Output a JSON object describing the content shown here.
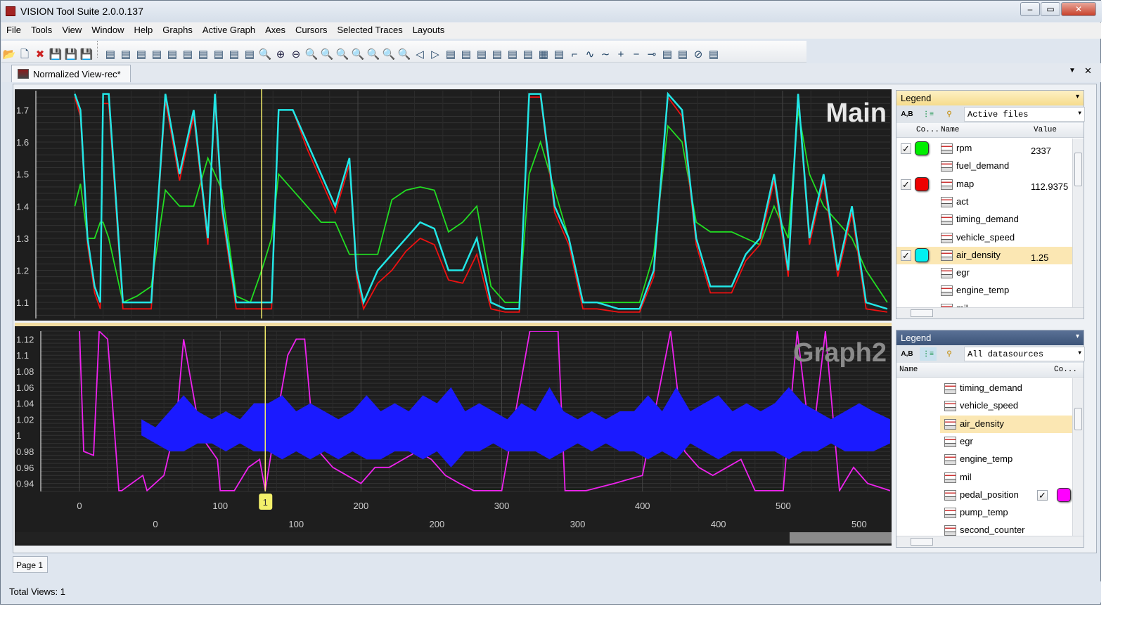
{
  "window": {
    "title": "VISION Tool Suite 2.0.0.137",
    "minimize": "–",
    "maximize": "▭",
    "close": "✕"
  },
  "menu": [
    "File",
    "Tools",
    "View",
    "Window",
    "Help",
    "Graphs",
    "Active Graph",
    "Axes",
    "Cursors",
    "Selected Traces",
    "Layouts"
  ],
  "toolbar": [
    "open-folder",
    "new-file",
    "close-file",
    "save",
    "save-as",
    "save-all",
    "sep",
    "add-table",
    "remove-table",
    "table-props",
    "y-axis-table",
    "y-axis-1",
    "y-axis-2",
    "open-layout",
    "layout-1",
    "layout-2",
    "layout-3",
    "zoom-fit",
    "zoom-in",
    "zoom-out",
    "zoom-horizontal",
    "zoom-vertical",
    "zoom-cursor",
    "zoom-help",
    "zoom-back",
    "zoom-disabled",
    "zoom-full",
    "cursor-left",
    "cursor-right",
    "cursor-numbers",
    "cursor-table",
    "traces-check",
    "traces-uncheck",
    "trace-edit",
    "trace-stack",
    "grid",
    "line-points",
    "line-steps",
    "line-smooth",
    "line-wave",
    "add",
    "remove",
    "link",
    "link-points",
    "annotate",
    "clear-graph",
    "color-map"
  ],
  "document_tab": "Normalized View-rec*",
  "graphs": [
    {
      "title": "Main",
      "cursor_label": "1"
    },
    {
      "title": "Graph2",
      "cursor_label": "1"
    }
  ],
  "legend_top": {
    "header": "Legend",
    "pin": "📌",
    "tool_ab": "A,B",
    "filter": "Active files",
    "columns": {
      "color": "Co...",
      "name": "Name",
      "value": "Value"
    },
    "rows": [
      {
        "name": "rpm",
        "checked": true,
        "color": "#00ee00",
        "value": "2337"
      },
      {
        "name": "fuel_demand"
      },
      {
        "name": "map",
        "checked": true,
        "color": "#ee0000",
        "value": "112.9375"
      },
      {
        "name": "act"
      },
      {
        "name": "timing_demand"
      },
      {
        "name": "vehicle_speed"
      },
      {
        "name": "air_density",
        "checked": true,
        "color": "#00f0f0",
        "value": "1.25",
        "selected": true
      },
      {
        "name": "egr"
      },
      {
        "name": "engine_temp"
      },
      {
        "name": "mil"
      }
    ]
  },
  "legend_bottom": {
    "header": "Legend",
    "pin": "📌",
    "tool_ab": "A,B",
    "filter": "All datasources",
    "columns": {
      "name": "Name",
      "color": "Co..."
    },
    "rows": [
      {
        "name": "timing_demand"
      },
      {
        "name": "vehicle_speed"
      },
      {
        "name": "air_density",
        "selected": true
      },
      {
        "name": "egr"
      },
      {
        "name": "engine_temp"
      },
      {
        "name": "mil"
      },
      {
        "name": "pedal_position",
        "checked": true,
        "color": "#ff00ff"
      },
      {
        "name": "pump_temp"
      },
      {
        "name": "second_counter"
      }
    ]
  },
  "page_tab": "Page 1",
  "status": "Total Views: 1",
  "chart_data": [
    {
      "type": "line",
      "title": "Main",
      "ylim": [
        1.05,
        1.76
      ],
      "xlim": [
        -27.5,
        576
      ],
      "yticks": [
        "1.7",
        "1.6",
        "1.5",
        "1.4",
        "1.3",
        "1.2",
        "1.1"
      ],
      "grid": true,
      "cursor_x": 132,
      "x": [
        0,
        4,
        9,
        14,
        18,
        20,
        24,
        34,
        44,
        54,
        64,
        74,
        84,
        94,
        99,
        104,
        114,
        124,
        132,
        139,
        144,
        154,
        164,
        174,
        184,
        194,
        199,
        204,
        214,
        224,
        234,
        244,
        254,
        264,
        274,
        284,
        294,
        304,
        314,
        321,
        329,
        339,
        349,
        359,
        369,
        384,
        399,
        409,
        419,
        429,
        439,
        449,
        464,
        474,
        484,
        494,
        504,
        511,
        519,
        529,
        539,
        549,
        559,
        574
      ],
      "series": [
        {
          "name": "rpm",
          "color": "#22dd22",
          "values": [
            1.4,
            1.47,
            1.3,
            1.3,
            1.35,
            1.35,
            1.3,
            1.1,
            1.12,
            1.15,
            1.45,
            1.4,
            1.4,
            1.55,
            1.5,
            1.45,
            1.12,
            1.1,
            1.2,
            1.3,
            1.5,
            1.45,
            1.4,
            1.35,
            1.35,
            1.25,
            1.25,
            1.25,
            1.25,
            1.42,
            1.45,
            1.46,
            1.45,
            1.32,
            1.35,
            1.4,
            1.15,
            1.1,
            1.1,
            1.5,
            1.6,
            1.45,
            1.3,
            1.1,
            1.1,
            1.1,
            1.1,
            1.25,
            1.65,
            1.6,
            1.35,
            1.32,
            1.32,
            1.3,
            1.28,
            1.4,
            1.3,
            1.7,
            1.5,
            1.4,
            1.35,
            1.3,
            1.2,
            1.1
          ]
        },
        {
          "name": "map",
          "color": "#ee1111",
          "values": [
            1.74,
            1.68,
            1.28,
            1.13,
            1.08,
            1.72,
            1.72,
            1.08,
            1.08,
            1.08,
            1.73,
            1.48,
            1.68,
            1.28,
            1.73,
            1.38,
            1.08,
            1.08,
            1.08,
            1.08,
            1.7,
            1.7,
            1.58,
            1.48,
            1.38,
            1.53,
            1.18,
            1.08,
            1.16,
            1.2,
            1.26,
            1.3,
            1.28,
            1.17,
            1.16,
            1.25,
            1.08,
            1.07,
            1.07,
            1.74,
            1.74,
            1.38,
            1.28,
            1.08,
            1.08,
            1.07,
            1.07,
            1.18,
            1.74,
            1.68,
            1.28,
            1.13,
            1.13,
            1.23,
            1.28,
            1.48,
            1.18,
            1.74,
            1.28,
            1.48,
            1.18,
            1.38,
            1.08,
            1.07
          ]
        },
        {
          "name": "air_density",
          "color": "#22e6e6",
          "values": [
            1.75,
            1.7,
            1.3,
            1.15,
            1.1,
            1.75,
            1.75,
            1.1,
            1.1,
            1.1,
            1.75,
            1.5,
            1.7,
            1.3,
            1.75,
            1.4,
            1.1,
            1.1,
            1.1,
            1.1,
            1.7,
            1.7,
            1.6,
            1.5,
            1.4,
            1.55,
            1.2,
            1.1,
            1.2,
            1.25,
            1.3,
            1.35,
            1.33,
            1.2,
            1.2,
            1.3,
            1.1,
            1.08,
            1.08,
            1.75,
            1.75,
            1.4,
            1.3,
            1.1,
            1.1,
            1.08,
            1.08,
            1.2,
            1.75,
            1.7,
            1.3,
            1.15,
            1.15,
            1.25,
            1.3,
            1.5,
            1.2,
            1.75,
            1.3,
            1.5,
            1.2,
            1.4,
            1.1,
            1.08
          ]
        }
      ]
    },
    {
      "type": "line",
      "title": "Graph2",
      "ylim": [
        0.93,
        1.13
      ],
      "xlim": [
        -27.5,
        576
      ],
      "yticks": [
        "1.12",
        "1.1",
        "1.08",
        "1.06",
        "1.04",
        "1.02",
        "1",
        "0.98",
        "0.96",
        "0.94"
      ],
      "xticks_primary": [
        "0",
        "100",
        "200",
        "300",
        "400",
        "500"
      ],
      "xticks_secondary": [
        "0",
        "100",
        "200",
        "300",
        "400",
        "500"
      ],
      "grid": true,
      "cursor_x": 132,
      "series": [
        {
          "name": "pedal_position",
          "color": "#ee22ee",
          "x": [
            0,
            3,
            10,
            14,
            20,
            28,
            30,
            45,
            48,
            60,
            64,
            70,
            74,
            80,
            84,
            90,
            98,
            100,
            110,
            120,
            128,
            132,
            140,
            148,
            154,
            160,
            164,
            170,
            180,
            190,
            200,
            210,
            220,
            230,
            240,
            250,
            260,
            270,
            280,
            300,
            320,
            340,
            345,
            360,
            380,
            400,
            420,
            430,
            440,
            450,
            460,
            470,
            480,
            500,
            510,
            520,
            530,
            540,
            550,
            560,
            576
          ],
          "values": [
            1.13,
            0.98,
            0.975,
            1.13,
            1.12,
            0.93,
            0.93,
            0.95,
            0.93,
            0.95,
            0.98,
            1.04,
            1.12,
            1.06,
            1.02,
            0.99,
            0.97,
            0.93,
            0.93,
            0.96,
            0.97,
            0.93,
            1.02,
            1.1,
            1.12,
            1.12,
            1.04,
            0.98,
            0.96,
            0.95,
            0.94,
            0.96,
            0.96,
            0.97,
            0.98,
            0.97,
            0.95,
            0.94,
            0.93,
            0.93,
            1.13,
            1.13,
            0.93,
            0.93,
            0.94,
            0.95,
            1.13,
            0.98,
            0.96,
            0.95,
            0.96,
            0.97,
            0.93,
            0.93,
            1.13,
            0.98,
            1.13,
            0.93,
            0.96,
            0.94,
            0.93
          ]
        },
        {
          "color": "#1a1aff",
          "x": [
            44,
            54,
            64,
            74,
            84,
            94,
            104,
            114,
            124,
            134,
            144,
            154,
            164,
            174,
            184,
            194,
            204,
            214,
            224,
            234,
            244,
            254,
            264,
            274,
            284,
            294,
            304,
            314,
            324,
            334,
            344,
            354,
            364,
            374,
            384,
            394,
            404,
            414,
            424,
            434,
            444,
            454,
            464,
            474,
            484,
            494,
            504,
            514,
            524,
            534,
            544,
            554,
            564,
            576
          ],
          "upper": [
            1.02,
            1.01,
            1.03,
            1.05,
            1.03,
            1.02,
            1.03,
            1.02,
            1.04,
            1.04,
            1.05,
            1.03,
            1.04,
            1.03,
            1.02,
            1.03,
            1.05,
            1.03,
            1.04,
            1.03,
            1.05,
            1.04,
            1.06,
            1.03,
            1.04,
            1.03,
            1.02,
            1.04,
            1.03,
            1.06,
            1.03,
            1.02,
            1.03,
            1.02,
            1.03,
            1.03,
            1.05,
            1.03,
            1.06,
            1.03,
            1.04,
            1.05,
            1.03,
            1.04,
            1.03,
            1.04,
            1.06,
            1.04,
            1.03,
            1.02,
            1.03,
            1.04,
            1.03,
            1.02
          ],
          "lower": [
            1.0,
            0.99,
            0.98,
            0.98,
            0.99,
            0.99,
            0.98,
            0.99,
            0.98,
            0.98,
            0.97,
            0.98,
            0.97,
            0.98,
            0.97,
            0.98,
            0.97,
            0.97,
            0.98,
            0.98,
            0.97,
            0.98,
            0.96,
            0.98,
            0.98,
            0.99,
            0.98,
            0.98,
            0.98,
            0.97,
            0.98,
            0.99,
            0.98,
            0.99,
            0.98,
            0.98,
            0.97,
            0.98,
            0.97,
            0.99,
            0.98,
            0.97,
            0.98,
            0.98,
            0.98,
            0.98,
            0.97,
            0.98,
            0.98,
            0.99,
            0.98,
            0.98,
            0.98,
            0.99
          ]
        }
      ]
    }
  ]
}
